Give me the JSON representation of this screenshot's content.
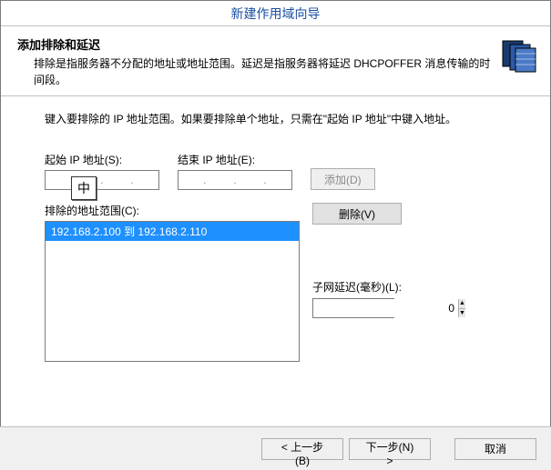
{
  "titlebar": "新建作用域向导",
  "header": {
    "title": "添加排除和延迟",
    "desc": "排除是指服务器不分配的地址或地址范围。延迟是指服务器将延迟 DHCPOFFER 消息传输的时间段。"
  },
  "content": {
    "instruction": "键入要排除的 IP 地址范围。如果要排除单个地址，只需在\"起始 IP 地址\"中键入地址。",
    "start_label": "起始 IP 地址(S):",
    "end_label": "结束 IP 地址(E):",
    "add_btn": "添加(D)",
    "list_label": "排除的地址范围(C):",
    "list_items": [
      "192.168.2.100 到 192.168.2.110"
    ],
    "remove_btn": "删除(V)",
    "delay_label": "子网延迟(毫秒)(L):",
    "delay_value": "0"
  },
  "ime": "中",
  "footer": {
    "back": "< 上一步(B)",
    "next": "下一步(N) >",
    "cancel": "取消"
  }
}
